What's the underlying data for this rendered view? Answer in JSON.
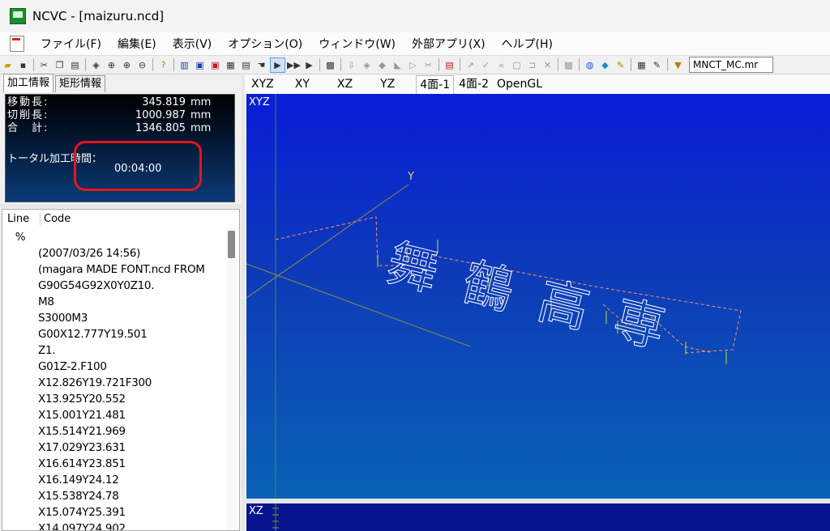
{
  "window": {
    "title": "NCVC - [maizuru.ncd]",
    "app_icon": "ncvc-app-icon"
  },
  "menu": {
    "items": [
      "ファイル(F)",
      "編集(E)",
      "表示(V)",
      "オプション(O)",
      "ウィンドウ(W)",
      "外部アプリ(X)",
      "ヘルプ(H)"
    ]
  },
  "toolbar": {
    "machine_combo": "MNCT_MC.mr"
  },
  "left_panel": {
    "tabs": [
      "加工情報",
      "矩形情報"
    ],
    "info": {
      "move_label": "移動長:",
      "move_value": "345.819",
      "move_unit": "mm",
      "cut_label": "切削長:",
      "cut_value": "1000.987",
      "cut_unit": "mm",
      "total_label": "合　計:",
      "total_value": "1346.805",
      "total_unit": "mm",
      "time_label": "トータル加工時間：",
      "time_value": "00:04:00"
    },
    "code_header": {
      "line": "Line",
      "code": "Code"
    },
    "code_lines": [
      {
        "ln": "%",
        "code": ""
      },
      {
        "ln": "",
        "code": "(2007/03/26 14:56)"
      },
      {
        "ln": "",
        "code": "(magara MADE FONT.ncd FROM"
      },
      {
        "ln": "",
        "code": "G90G54G92X0Y0Z10."
      },
      {
        "ln": "",
        "code": "M8"
      },
      {
        "ln": "",
        "code": "S3000M3"
      },
      {
        "ln": "",
        "code": "G00X12.777Y19.501"
      },
      {
        "ln": "",
        "code": "Z1."
      },
      {
        "ln": "",
        "code": "G01Z-2.F100"
      },
      {
        "ln": "",
        "code": "X12.826Y19.721F300"
      },
      {
        "ln": "",
        "code": "X13.925Y20.552"
      },
      {
        "ln": "",
        "code": "X15.001Y21.481"
      },
      {
        "ln": "",
        "code": "X15.514Y21.969"
      },
      {
        "ln": "",
        "code": "X17.029Y23.631"
      },
      {
        "ln": "",
        "code": "X16.614Y23.851"
      },
      {
        "ln": "",
        "code": "X16.149Y24.12"
      },
      {
        "ln": "",
        "code": "X15.538Y24.78"
      },
      {
        "ln": "",
        "code": "X15.074Y25.391"
      },
      {
        "ln": "",
        "code": "X14.097Y24.902"
      }
    ]
  },
  "view": {
    "tabs": [
      "XYZ",
      "XY",
      "XZ",
      "YZ",
      "4面-1",
      "4面-2",
      "OpenGL"
    ],
    "active_tab": "4面-1",
    "main_label": "XYZ",
    "axis_y_label": "Y",
    "sub_label": "XZ",
    "engraved_text": "舞鶴高専"
  }
}
